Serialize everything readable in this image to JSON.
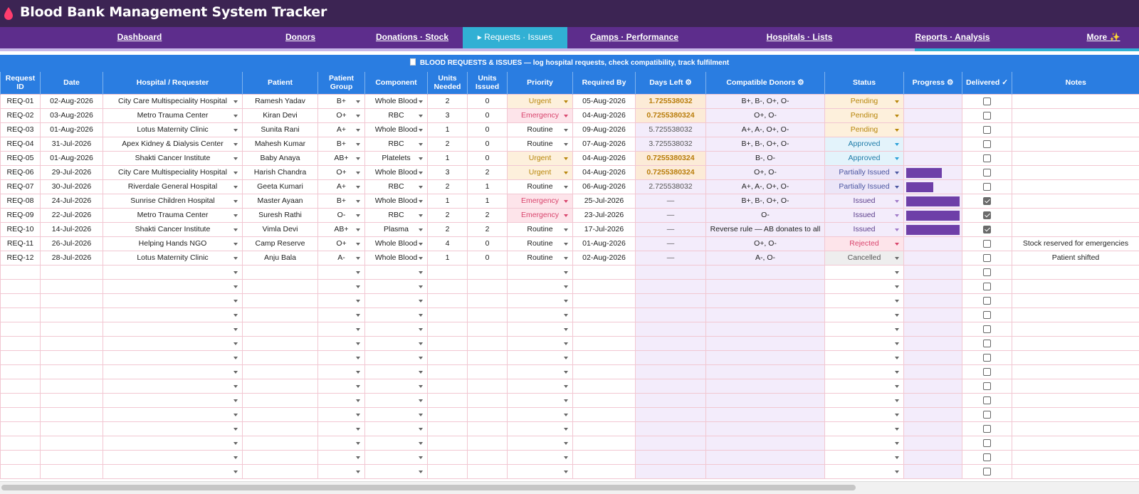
{
  "app": {
    "title": "Blood Bank Management System Tracker"
  },
  "nav": {
    "tabs": [
      {
        "label": "Dashboard"
      },
      {
        "label": "Donors"
      },
      {
        "label": "Donations · Stock"
      },
      {
        "label": "▸ Requests · Issues",
        "active": true
      },
      {
        "label": "Camps · Performance"
      },
      {
        "label": "Hospitals · Lists"
      },
      {
        "label": "Reports · Analysis"
      },
      {
        "label": "More ✨"
      }
    ]
  },
  "section": {
    "banner": "BLOOD REQUESTS & ISSUES — log hospital requests, check compatibility, track fulfilment"
  },
  "columns": [
    "Request ID",
    "Date",
    "Hospital / Requester",
    "Patient",
    "Patient Group",
    "Component",
    "Units Needed",
    "Units Issued",
    "Priority",
    "Required By",
    "Days Left ⚙",
    "Compatible Donors ⚙",
    "Status",
    "Progress ⚙",
    "Delivered ✓",
    "Notes"
  ],
  "rows": [
    {
      "id": "REQ-01",
      "date": "02-Aug-2026",
      "hospital": "City Care Multispeciality Hospital",
      "patient": "Ramesh Yadav",
      "group": "B+",
      "component": "Whole Blood",
      "needed": "2",
      "issued": "0",
      "priority": "Urgent",
      "required": "05-Aug-2026",
      "days": "1.725538032",
      "donors": "B+, B-, O+, O-",
      "status": "Pending",
      "progress": 0,
      "delivered": false,
      "notes": ""
    },
    {
      "id": "REQ-02",
      "date": "03-Aug-2026",
      "hospital": "Metro Trauma Center",
      "patient": "Kiran Devi",
      "group": "O+",
      "component": "RBC",
      "needed": "3",
      "issued": "0",
      "priority": "Emergency",
      "required": "04-Aug-2026",
      "days": "0.7255380324",
      "donors": "O+, O-",
      "status": "Pending",
      "progress": 0,
      "delivered": false,
      "notes": ""
    },
    {
      "id": "REQ-03",
      "date": "01-Aug-2026",
      "hospital": "Lotus Maternity Clinic",
      "patient": "Sunita Rani",
      "group": "A+",
      "component": "Whole Blood",
      "needed": "1",
      "issued": "0",
      "priority": "Routine",
      "required": "09-Aug-2026",
      "days": "5.725538032",
      "donors": "A+, A-, O+, O-",
      "status": "Pending",
      "progress": 0,
      "delivered": false,
      "notes": ""
    },
    {
      "id": "REQ-04",
      "date": "31-Jul-2026",
      "hospital": "Apex Kidney & Dialysis Center",
      "patient": "Mahesh Kumar",
      "group": "B+",
      "component": "RBC",
      "needed": "2",
      "issued": "0",
      "priority": "Routine",
      "required": "07-Aug-2026",
      "days": "3.725538032",
      "donors": "B+, B-, O+, O-",
      "status": "Approved",
      "progress": 0,
      "delivered": false,
      "notes": ""
    },
    {
      "id": "REQ-05",
      "date": "01-Aug-2026",
      "hospital": "Shakti Cancer Institute",
      "patient": "Baby Anaya",
      "group": "AB+",
      "component": "Platelets",
      "needed": "1",
      "issued": "0",
      "priority": "Urgent",
      "required": "04-Aug-2026",
      "days": "0.7255380324",
      "donors": "B-, O-",
      "status": "Approved",
      "progress": 0,
      "delivered": false,
      "notes": ""
    },
    {
      "id": "REQ-06",
      "date": "29-Jul-2026",
      "hospital": "City Care Multispeciality Hospital",
      "patient": "Harish Chandra",
      "group": "O+",
      "component": "Whole Blood",
      "needed": "3",
      "issued": "2",
      "priority": "Urgent",
      "required": "04-Aug-2026",
      "days": "0.7255380324",
      "donors": "O+, O-",
      "status": "Partially Issued",
      "progress": 0.667,
      "delivered": false,
      "notes": ""
    },
    {
      "id": "REQ-07",
      "date": "30-Jul-2026",
      "hospital": "Riverdale General Hospital",
      "patient": "Geeta Kumari",
      "group": "A+",
      "component": "RBC",
      "needed": "2",
      "issued": "1",
      "priority": "Routine",
      "required": "06-Aug-2026",
      "days": "2.725538032",
      "donors": "A+, A-, O+, O-",
      "status": "Partially Issued",
      "progress": 0.5,
      "delivered": false,
      "notes": ""
    },
    {
      "id": "REQ-08",
      "date": "24-Jul-2026",
      "hospital": "Sunrise Children Hospital",
      "patient": "Master Ayaan",
      "group": "B+",
      "component": "Whole Blood",
      "needed": "1",
      "issued": "1",
      "priority": "Emergency",
      "required": "25-Jul-2026",
      "days": "—",
      "donors": "B+, B-, O+, O-",
      "status": "Issued",
      "progress": 1,
      "delivered": true,
      "notes": ""
    },
    {
      "id": "REQ-09",
      "date": "22-Jul-2026",
      "hospital": "Metro Trauma Center",
      "patient": "Suresh Rathi",
      "group": "O-",
      "component": "RBC",
      "needed": "2",
      "issued": "2",
      "priority": "Emergency",
      "required": "23-Jul-2026",
      "days": "—",
      "donors": "O-",
      "status": "Issued",
      "progress": 1,
      "delivered": true,
      "notes": ""
    },
    {
      "id": "REQ-10",
      "date": "14-Jul-2026",
      "hospital": "Shakti Cancer Institute",
      "patient": "Vimla Devi",
      "group": "AB+",
      "component": "Plasma",
      "needed": "2",
      "issued": "2",
      "priority": "Routine",
      "required": "17-Jul-2026",
      "days": "—",
      "donors": "Reverse rule — AB donates to all",
      "status": "Issued",
      "progress": 1,
      "delivered": true,
      "notes": ""
    },
    {
      "id": "REQ-11",
      "date": "26-Jul-2026",
      "hospital": "Helping Hands NGO",
      "patient": "Camp Reserve",
      "group": "O+",
      "component": "Whole Blood",
      "needed": "4",
      "issued": "0",
      "priority": "Routine",
      "required": "01-Aug-2026",
      "days": "—",
      "donors": "O+, O-",
      "status": "Rejected",
      "progress": 0,
      "delivered": false,
      "notes": "Stock reserved for emergencies"
    },
    {
      "id": "REQ-12",
      "date": "28-Jul-2026",
      "hospital": "Lotus Maternity Clinic",
      "patient": "Anju Bala",
      "group": "A-",
      "component": "Whole Blood",
      "needed": "1",
      "issued": "0",
      "priority": "Routine",
      "required": "02-Aug-2026",
      "days": "—",
      "donors": "A-, O-",
      "status": "Cancelled",
      "progress": 0,
      "delivered": false,
      "notes": "Patient shifted"
    }
  ],
  "empty_rows": 15,
  "colors": {
    "title_bg": "#3c2453",
    "nav_bg": "#5d2d8c",
    "active_tab": "#31b0d4",
    "header_bg": "#2a7de1",
    "progress_bar": "#6e3fa8",
    "drop": "#ff3d6e"
  }
}
